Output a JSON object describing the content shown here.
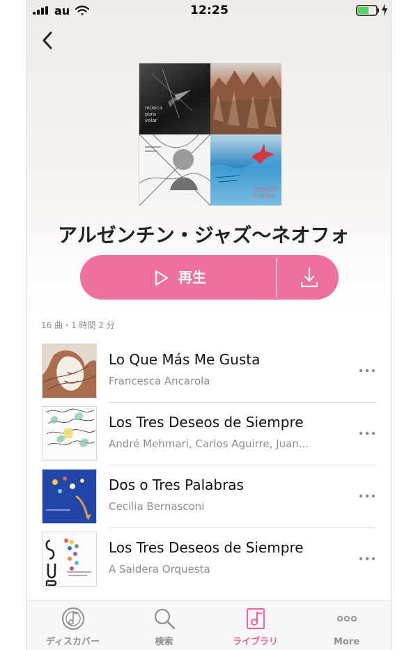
{
  "status_bar": {
    "carrier": "au",
    "time": "12:25",
    "charging_icon": "bolt-icon"
  },
  "navigation": {
    "back_icon": "chevron-left-icon"
  },
  "playlist": {
    "title": "アルゼンチン・ジャズ〜ネオフォ",
    "meta": "16 曲・1 時間 2 分",
    "play_label": "再生",
    "accent_color": "#ef6f9e"
  },
  "cover_tiles": [
    {
      "id": "musica-para-volar",
      "caption": "música\npara\nvolar"
    },
    {
      "id": "canyon-cover",
      "caption": ""
    },
    {
      "id": "illustrated-portrait-cover",
      "caption": ""
    },
    {
      "id": "red-bird-cover",
      "caption": "Imperio\nCarlos"
    }
  ],
  "tracks": [
    {
      "title": "Lo Que Más Me Gusta",
      "artist": "Francesca Ancarola",
      "more_icon": "more-horizontal-icon"
    },
    {
      "title": "Los Tres Deseos de Siempre",
      "artist": "André Mehmari, Carlos Aguirre, Juan...",
      "more_icon": "more-horizontal-icon"
    },
    {
      "title": "Dos o Tres Palabras",
      "artist": "Cecilia Bernasconi",
      "more_icon": "more-horizontal-icon"
    },
    {
      "title": "Los Tres Deseos de Siempre",
      "artist": "A Saidera Orquesta",
      "more_icon": "more-horizontal-icon"
    }
  ],
  "tabs": [
    {
      "label": "ディスカバー",
      "icon": "discover-icon",
      "active": false
    },
    {
      "label": "検索",
      "icon": "search-icon",
      "active": false
    },
    {
      "label": "ライブラリ",
      "icon": "library-icon",
      "active": true
    },
    {
      "label": "More",
      "icon": "more-horizontal-icon",
      "active": false
    }
  ]
}
